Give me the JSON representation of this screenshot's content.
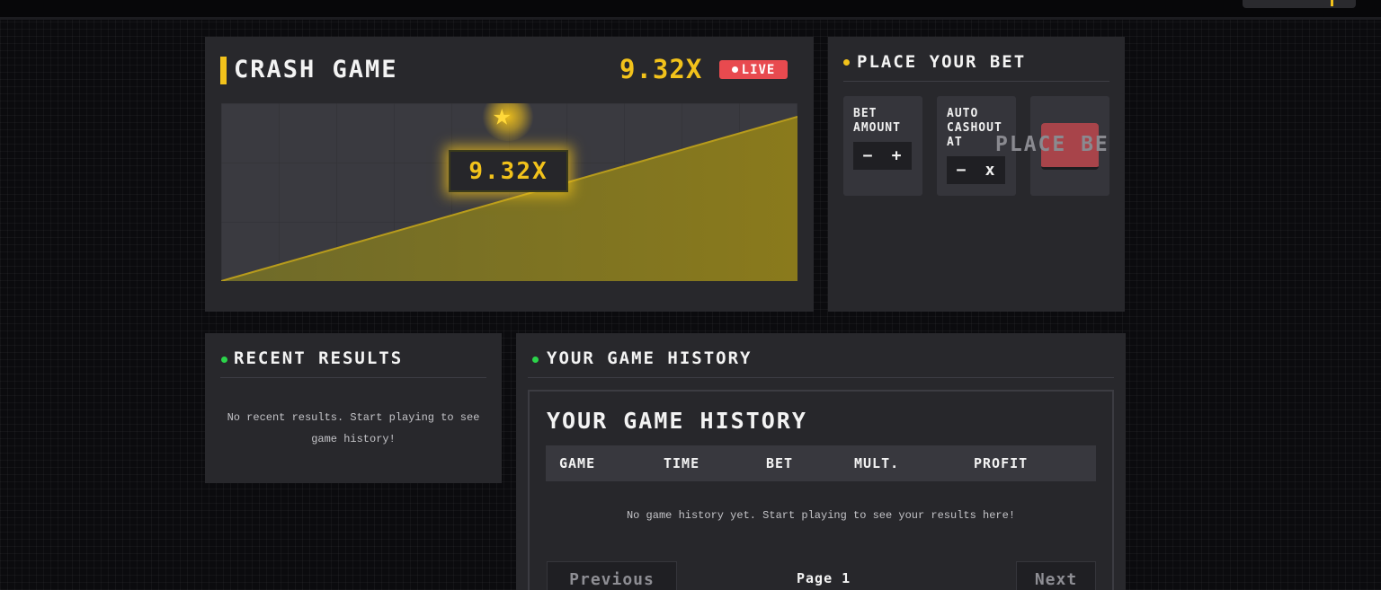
{
  "crash_game": {
    "title": "CRASH GAME",
    "multiplier": "9.32x",
    "live_label": "LIVE",
    "graph_multiplier": "9.32x",
    "accent_color": "#f2c21b",
    "live_color": "#e84a4f"
  },
  "bet": {
    "title": "PLACE YOUR BET",
    "bet_amount_label": "BET AMOUNT",
    "bet_minus": "−",
    "bet_plus": "+",
    "cashout_label": "AUTO CASHOUT AT",
    "cashout_minus": "−",
    "cashout_suffix": "x",
    "place_button": "PLACE BE"
  },
  "recent_results": {
    "title": "RECENT RESULTS",
    "empty_message": "No recent results. Start playing to see game history!"
  },
  "history": {
    "title": "YOUR GAME HISTORY",
    "inner_title": "YOUR GAME HISTORY",
    "columns": [
      "GAME",
      "TIME",
      "BET",
      "MULT.",
      "PROFIT"
    ],
    "empty_message": "No game history yet. Start playing to see your results here!",
    "previous_button": "Previous",
    "page_label": "Page 1",
    "next_button": "Next"
  },
  "status_dot_color": "#2bd44a"
}
